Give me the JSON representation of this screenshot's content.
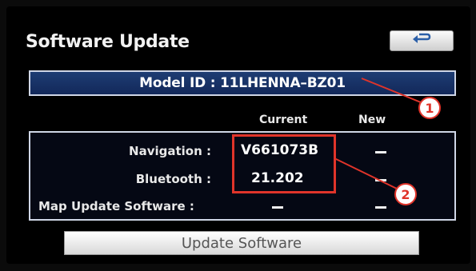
{
  "screen": {
    "title": "Software Update",
    "model_id": "Model ID : 11LHENNA–BZ01",
    "columns": {
      "current": "Current",
      "new": "New"
    },
    "rows": [
      {
        "label": "Navigation :",
        "current": "V661073B",
        "new": "–"
      },
      {
        "label": "Bluetooth :",
        "current": "21.202",
        "new": "–"
      },
      {
        "label": "Map Update Software :",
        "current": "–",
        "new": "–"
      }
    ],
    "update_button_label": "Update Software"
  },
  "icons": {
    "back": "back-arrow-icon"
  },
  "annotations": {
    "callout_1": "1",
    "callout_2": "2"
  },
  "colors": {
    "accent_blue": "#1e3d73",
    "annotation_red": "#e0342a"
  }
}
